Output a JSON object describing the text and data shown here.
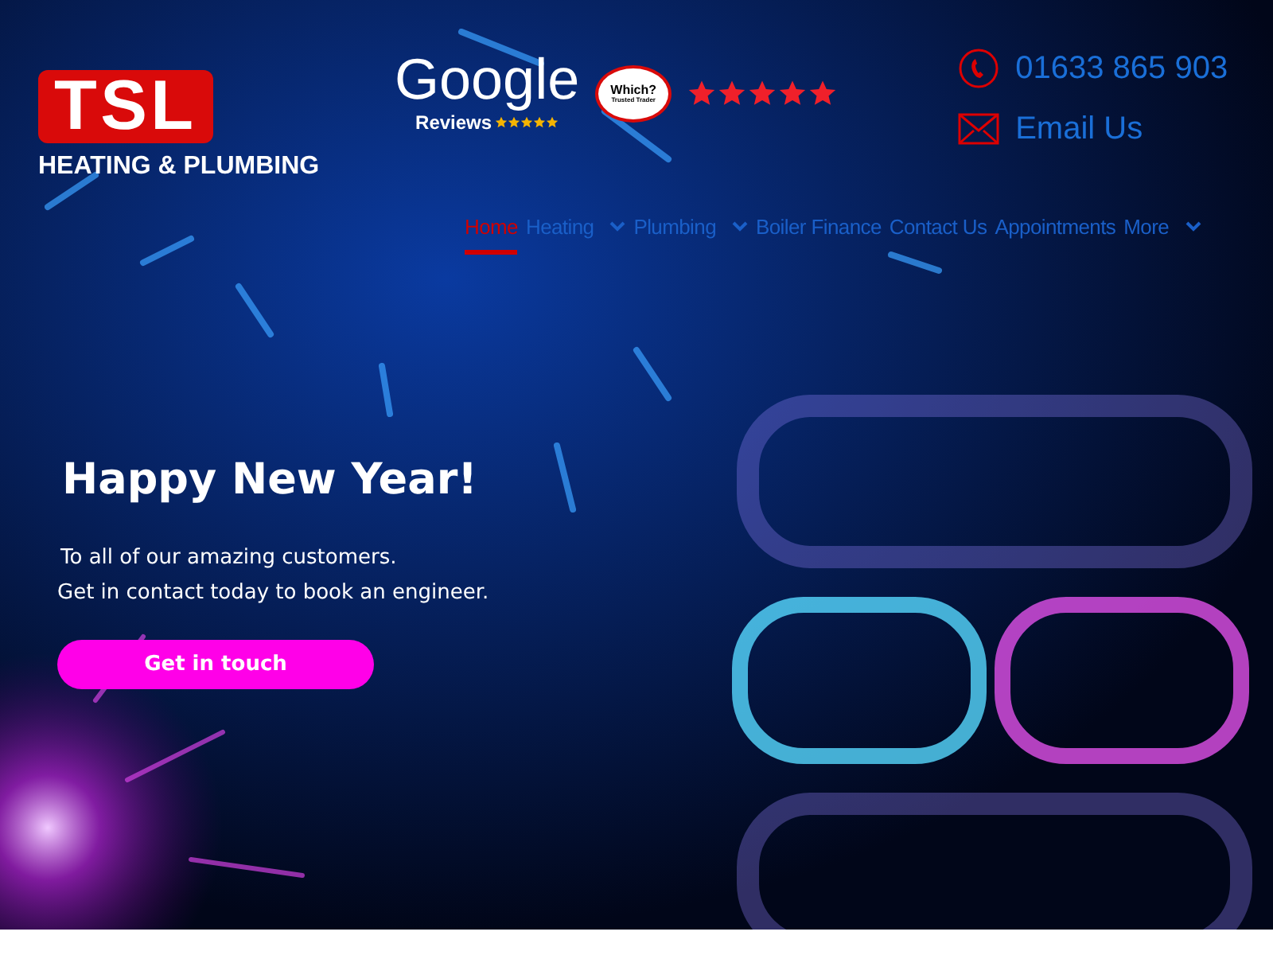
{
  "logo": {
    "mark": "TSL",
    "tagline": "HEATING & PLUMBING"
  },
  "badges": {
    "google": {
      "wordmark": "Google",
      "label": "Reviews",
      "stars": 5
    },
    "which": {
      "title": "Which?",
      "subtitle": "Trusted Trader"
    },
    "rating": {
      "stars": 5
    }
  },
  "contact": [
    {
      "kind": "phone",
      "text": "01633 865 903"
    },
    {
      "kind": "email",
      "text": "Email Us"
    }
  ],
  "nav": [
    {
      "label": "Home",
      "selected": true,
      "dropdown": false
    },
    {
      "label": "Heating",
      "selected": false,
      "dropdown": true
    },
    {
      "label": "Plumbing",
      "selected": false,
      "dropdown": true
    },
    {
      "label": "Boiler Finance",
      "selected": false,
      "dropdown": false
    },
    {
      "label": "Contact Us",
      "selected": false,
      "dropdown": false
    },
    {
      "label": "Appointments",
      "selected": false,
      "dropdown": false
    },
    {
      "label": "More",
      "selected": false,
      "dropdown": true
    }
  ],
  "hero": {
    "heading": "Happy New Year!",
    "lines": [
      "To all of our amazing customers.",
      "Get in contact today to book an engineer."
    ],
    "button": "Get in touch"
  }
}
